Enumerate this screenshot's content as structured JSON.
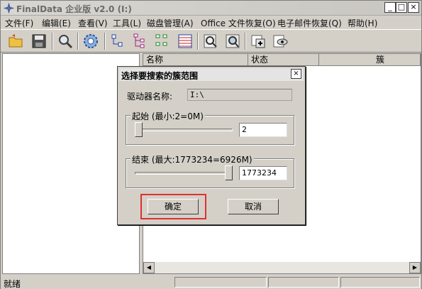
{
  "window": {
    "title": "FinalData 企业版 v2.0 (I:)",
    "minimize": "_",
    "maximize": "□",
    "close": "×"
  },
  "menu": [
    "文件(F)",
    "编辑(E)",
    "查看(V)",
    "工具(L)",
    "磁盘管理(A)",
    "Office 文件恢复(O)",
    "电子邮件恢复(Q)",
    "帮助(H)"
  ],
  "toolbar": {
    "icons": [
      "open-folder-icon",
      "save-disk-icon",
      "search-icon",
      "settings-gear-icon",
      "tree-view-small-icon",
      "tree-view-large-icon",
      "tree-view-green-icon",
      "grid-list-icon",
      "find-file-icon",
      "find-sector-icon",
      "add-window-icon",
      "preview-icon"
    ]
  },
  "file_list": {
    "columns": [
      "名称",
      "状态",
      "簇"
    ]
  },
  "scrollbar": {
    "left_arrow": "◀",
    "right_arrow": "▶"
  },
  "statusbar": {
    "text": "就绪"
  },
  "dialog": {
    "title": "选择要搜索的簇范围",
    "close": "×",
    "drive_label": "驱动器名称:",
    "drive_value": "I:\\",
    "start_group_label": "起始 (最小:2=0M)",
    "start_value": "2",
    "start_slider_fraction": 0.0,
    "end_group_label": "结束 (最大:1773234=6926M)",
    "end_value": "1773234",
    "end_slider_fraction": 1.0,
    "ok_button": "确定",
    "cancel_button": "取消"
  },
  "colors": {
    "highlight": "#e03030",
    "face": "#d4d0c8"
  }
}
